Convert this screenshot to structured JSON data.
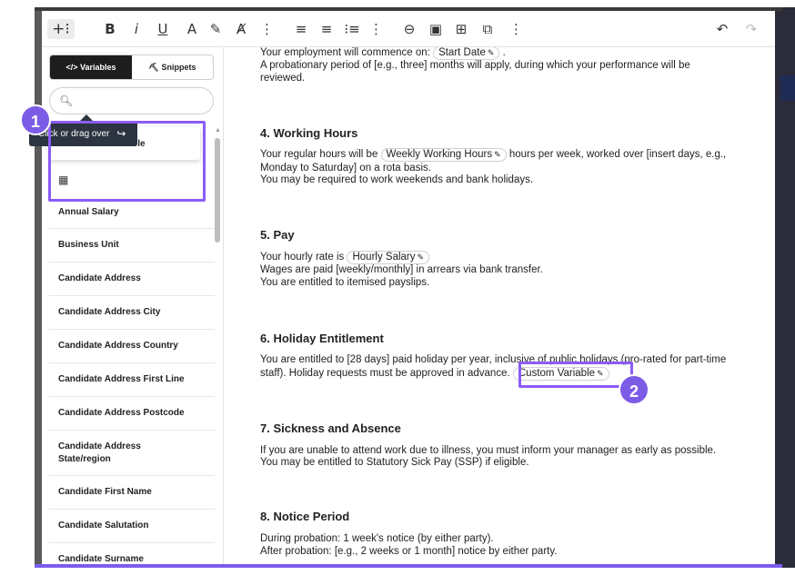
{
  "toolbar": {
    "insert_icon": "+⁝",
    "bold": "B",
    "italic": "i",
    "underline": "U",
    "text_color": "A",
    "highlight": "✎",
    "clear_format": "Ⱥ",
    "more1": "⋮",
    "align_left": "≡",
    "align_center": "≡",
    "list": "⁝≡",
    "more2": "⋮",
    "link": "⊖",
    "image": "▣",
    "table": "⊞",
    "special": "⧉",
    "more3": "⋮",
    "undo": "↶",
    "redo": "↷"
  },
  "sidebar": {
    "tab_variables": "</> Variables",
    "tab_snippets": "⛏ Snippets",
    "search_placeholder": "",
    "custom_variable": "</> Custom Variable",
    "calc_icon": "▦",
    "tooltip": "Click or drag over",
    "tooltip_icon": "↪",
    "items": [
      "Annual Salary",
      "Business Unit",
      "Candidate Address",
      "Candidate Address City",
      "Candidate Address Country",
      "Candidate Address First Line",
      "Candidate Address Postcode",
      "Candidate Address State/region",
      "Candidate First Name",
      "Candidate Salutation",
      "Candidate Surname"
    ]
  },
  "badges": {
    "one": "1",
    "two": "2"
  },
  "document": {
    "employment_prefix": "Your employment will commence on:",
    "start_date": "Start Date",
    "employment_suffix": ".",
    "probation": "A probationary period of [e.g., three] months will apply, during which your performance will be",
    "reviewed": "reviewed.",
    "h4": "4. Working Hours",
    "hours_prefix": "Your regular hours will be",
    "weekly_hours": "Weekly Working Hours",
    "hours_suffix": "hours per week, worked over [insert days, e.g.,",
    "hours_line2": "Monday to Saturday] on a rota basis.",
    "hours_line3": "You may be required to work weekends and bank holidays.",
    "h5": "5. Pay",
    "pay_prefix": "Your hourly rate is",
    "hourly_salary": "Hourly Salary",
    "pay_line2": "Wages are paid [weekly/monthly] in arrears via bank transfer.",
    "pay_line3": "You are entitled to itemised payslips.",
    "h6": "6. Holiday Entitlement",
    "holiday_line1": "You are entitled to [28 days] paid holiday per year, inclusive of public holidays (pro-rated for part-time",
    "holiday_line2": "staff). Holiday requests must be approved in advance.",
    "custom_variable": "Custom Variable",
    "h7": "7. Sickness and Absence",
    "sick_line1": "If you are unable to attend work due to illness, you must inform your manager as early as possible.",
    "sick_line2": "You may be entitled to Statutory Sick Pay (SSP) if eligible.",
    "h8": "8. Notice Period",
    "notice_line1": "During probation: 1 week's notice (by either party).",
    "notice_line2": "After probation: [e.g., 2 weeks or 1 month] notice by either party."
  },
  "colors": {
    "accent": "#8b5cf6",
    "badge": "#7c5ce6",
    "tooltip_bg": "#2b3440"
  }
}
